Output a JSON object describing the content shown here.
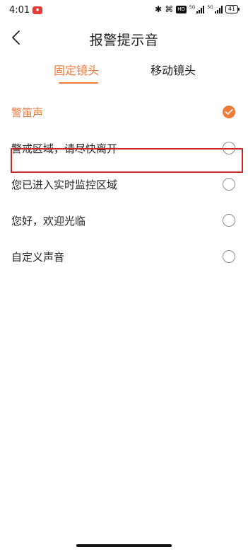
{
  "status_bar": {
    "time": "4:01",
    "signal_label_1": "5G",
    "signal_label_2": "5G",
    "hd_label": "HD",
    "battery": "41"
  },
  "header": {
    "title": "报警提示音"
  },
  "tabs": [
    {
      "label": "固定镜头",
      "active": true
    },
    {
      "label": "移动镜头",
      "active": false
    }
  ],
  "options": [
    {
      "label": "警笛声",
      "selected": true
    },
    {
      "label": "警戒区域，请尽快离开",
      "selected": false
    },
    {
      "label": "您已进入实时监控区域",
      "selected": false
    },
    {
      "label": "您好，欢迎光临",
      "selected": false
    },
    {
      "label": "自定义声音",
      "selected": false
    }
  ],
  "colors": {
    "accent": "#f07a3a",
    "highlight_border": "#c62828"
  },
  "icons": {
    "back": "chevron-left-icon",
    "check": "check-icon"
  }
}
